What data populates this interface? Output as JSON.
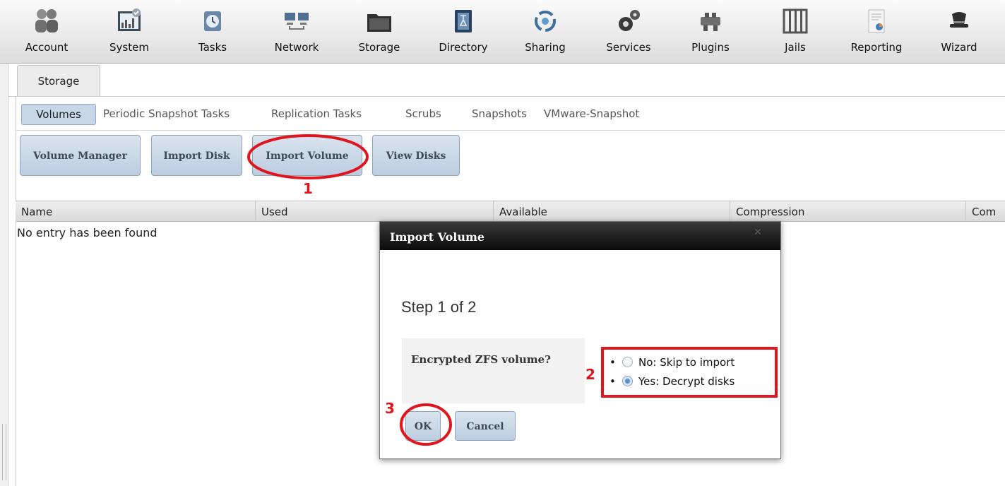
{
  "nav": {
    "items": [
      {
        "label": "Account",
        "icon": "account-icon"
      },
      {
        "label": "System",
        "icon": "system-icon"
      },
      {
        "label": "Tasks",
        "icon": "tasks-icon"
      },
      {
        "label": "Network",
        "icon": "network-icon"
      },
      {
        "label": "Storage",
        "icon": "storage-icon"
      },
      {
        "label": "Directory",
        "icon": "directory-icon"
      },
      {
        "label": "Sharing",
        "icon": "sharing-icon"
      },
      {
        "label": "Services",
        "icon": "services-icon"
      },
      {
        "label": "Plugins",
        "icon": "plugins-icon"
      },
      {
        "label": "Jails",
        "icon": "jails-icon"
      },
      {
        "label": "Reporting",
        "icon": "reporting-icon"
      },
      {
        "label": "Wizard",
        "icon": "wizard-icon"
      }
    ]
  },
  "main_tab": {
    "label": "Storage"
  },
  "subtabs": [
    {
      "label": "Volumes",
      "active": true
    },
    {
      "label": "Periodic Snapshot Tasks"
    },
    {
      "label": "Replication Tasks"
    },
    {
      "label": "Scrubs"
    },
    {
      "label": "Snapshots"
    },
    {
      "label": "VMware-Snapshot"
    }
  ],
  "actions": {
    "volume_manager": "Volume Manager",
    "import_disk": "Import Disk",
    "import_volume": "Import Volume",
    "view_disks": "View Disks"
  },
  "table": {
    "columns": [
      "Name",
      "Used",
      "Available",
      "Compression",
      "Com"
    ],
    "empty_message": "No entry has been found"
  },
  "dialog": {
    "title": "Import Volume",
    "close_symbol": "✕",
    "step": "Step 1 of 2",
    "question": "Encrypted ZFS volume?",
    "options": [
      {
        "bullet": "•",
        "label": "No: Skip to import",
        "checked": false
      },
      {
        "bullet": "•",
        "label": "Yes: Decrypt disks",
        "checked": true
      }
    ],
    "ok_label": "OK",
    "cancel_label": "Cancel"
  },
  "annotations": {
    "one": "1",
    "two": "2",
    "three": "3"
  },
  "colors": {
    "annotation_red": "#e0161f",
    "button_blue": "#c8d7e7",
    "dialog_title_bg": "#111111"
  }
}
